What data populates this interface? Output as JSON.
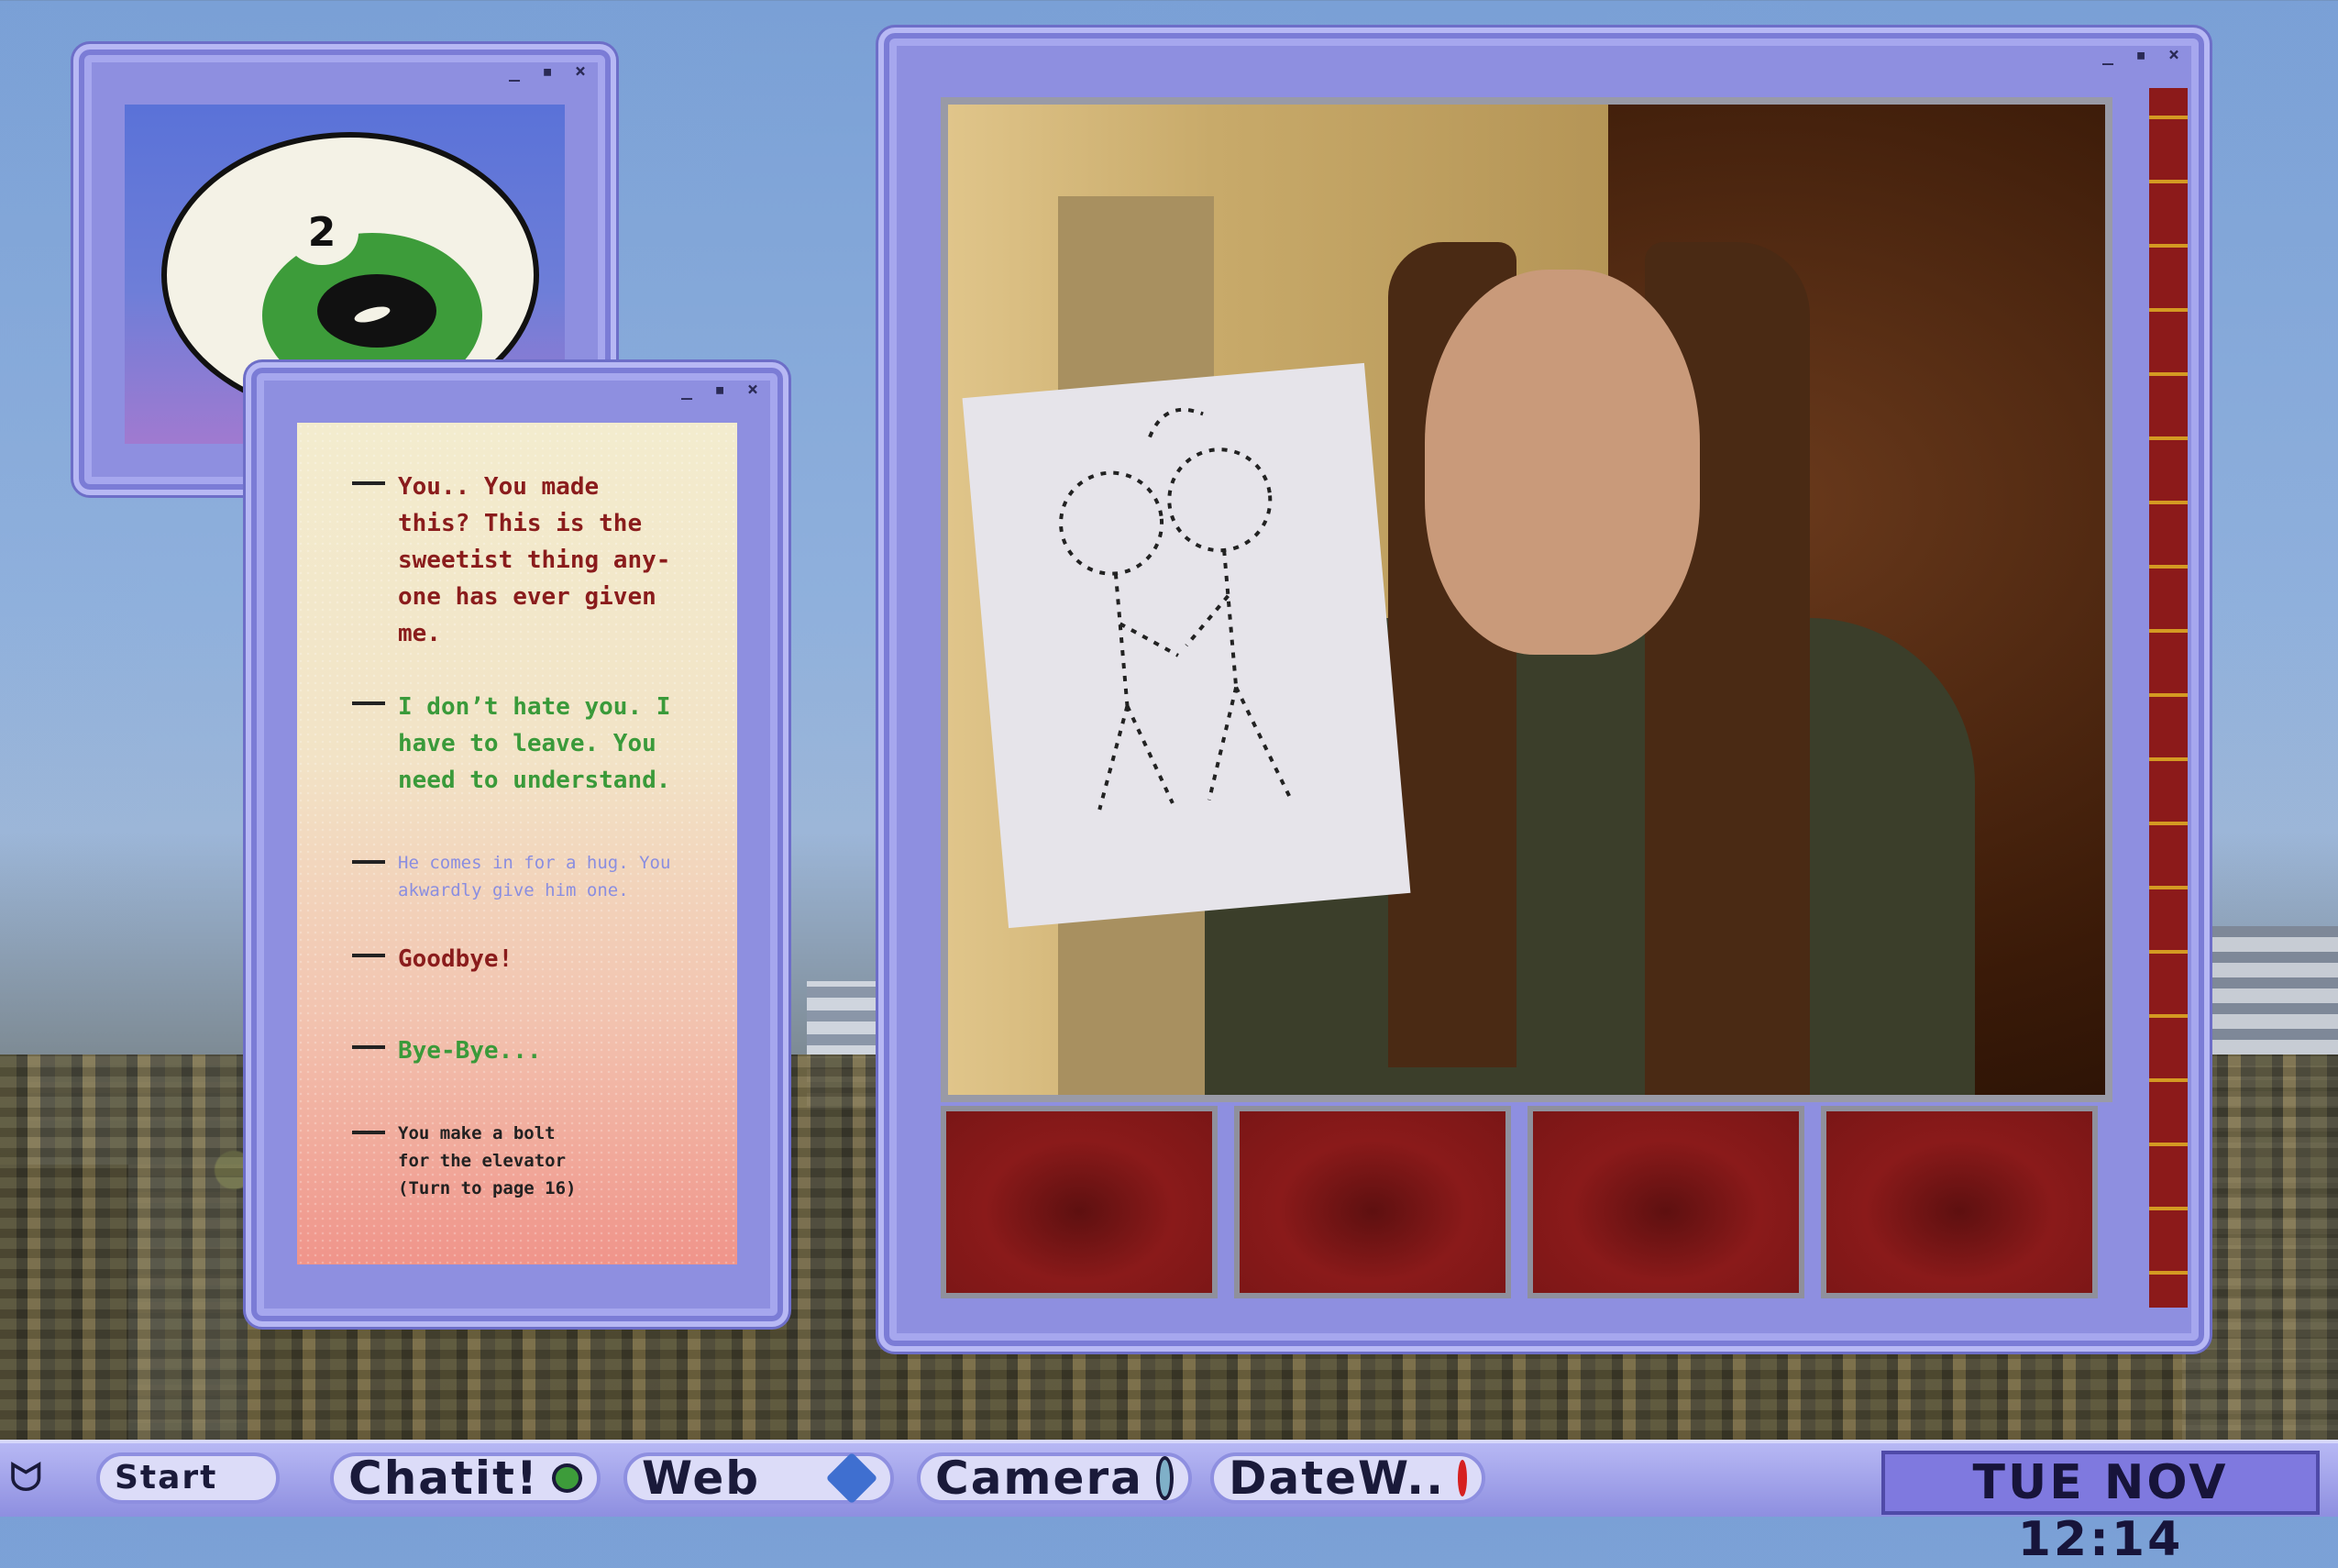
{
  "eye_window": {
    "bubble_text": "2"
  },
  "dialogue": {
    "lines": [
      {
        "text": "You.. You made\nthis? This is the\nsweetist thing any-\none has ever given\nme."
      },
      {
        "text": "I don’t hate you. I\nhave to leave. You\nneed to understand."
      },
      {
        "text": "He comes in for a hug. You\nakwardly give him one."
      },
      {
        "text": "Goodbye!"
      },
      {
        "text": "Bye-Bye..."
      },
      {
        "text": "You make a bolt\nfor the elevator\n(Turn to page 16)"
      }
    ]
  },
  "taskbar": {
    "start_label": "Start",
    "chat_label": "Chatit!",
    "web_label": "Web",
    "camera_label": "Camera",
    "date_label": "DateW..",
    "clock": "TUE NOV 12:14"
  },
  "colors": {
    "window": "#8e8fe0",
    "accent_red": "#8a1c1c",
    "accent_green": "#3a9a3a"
  }
}
